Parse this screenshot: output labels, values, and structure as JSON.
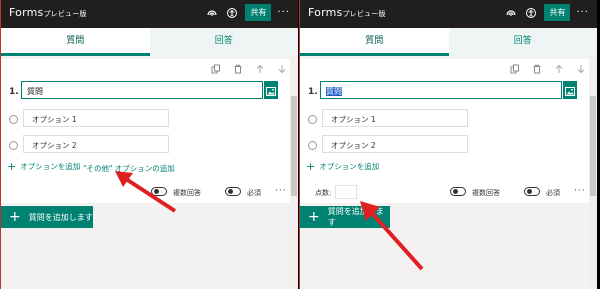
{
  "left": {
    "app": {
      "title": "Forms",
      "subtitle": "プレビュー版",
      "share": "共有",
      "more": "···"
    },
    "tabs": {
      "questions": "質問",
      "responses": "回答"
    },
    "question": {
      "number": "1.",
      "text": "質問"
    },
    "options": [
      {
        "label": "オプション 1"
      },
      {
        "label": "オプション 2"
      }
    ],
    "add_option": "オプションを追加",
    "add_other": "\"その他\" オプションの追加",
    "footer": {
      "multi": "複数回答",
      "required": "必須",
      "more": "···"
    },
    "add_question": "質問を追加します"
  },
  "right": {
    "app": {
      "title": "Forms",
      "subtitle": "プレビュー版",
      "share": "共有",
      "more": "···"
    },
    "tabs": {
      "questions": "質問",
      "responses": "回答"
    },
    "question": {
      "number": "1.",
      "text": "質問"
    },
    "options": [
      {
        "label": "オプション 1"
      },
      {
        "label": "オプション 2"
      }
    ],
    "add_option": "オプションを追加",
    "points_label": "点数:",
    "footer": {
      "multi": "複数回答",
      "required": "必須",
      "more": "···"
    },
    "add_question": "質問を追加します"
  },
  "colors": {
    "accent": "#008272",
    "topbar": "#201f1e",
    "arrow": "#e02020"
  },
  "icons": [
    "radar-icon",
    "accessibility-icon",
    "copy-icon",
    "trash-icon",
    "arrow-up-icon",
    "arrow-down-icon",
    "image-icon",
    "plus-icon"
  ]
}
